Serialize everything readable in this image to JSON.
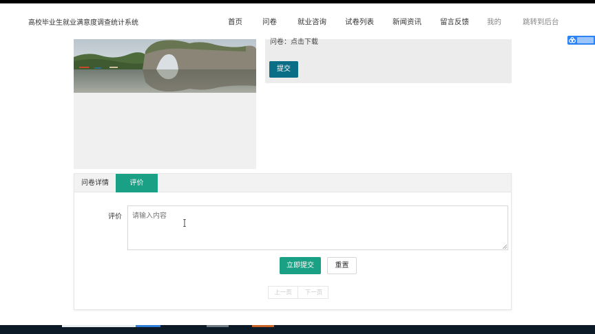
{
  "header": {
    "brand": "高校毕业生就业满意度调查统计系统",
    "nav": [
      {
        "label": "首页"
      },
      {
        "label": "问卷"
      },
      {
        "label": "就业咨询"
      },
      {
        "label": "试卷列表"
      },
      {
        "label": "新闻资讯"
      },
      {
        "label": "留言反馈"
      },
      {
        "label": "我的"
      },
      {
        "label": "跳转到后台"
      }
    ]
  },
  "info": {
    "file_text": "问卷：点击下载",
    "submit_label": "提交"
  },
  "tabs": [
    {
      "label": "问卷详情",
      "active": false
    },
    {
      "label": "评价",
      "active": true
    }
  ],
  "comment_form": {
    "label": "评价",
    "placeholder": "请输入内容",
    "value": "",
    "submit_label": "立即提交",
    "reset_label": "重置"
  },
  "pager": {
    "prev_label": "上一页",
    "next_label": "下一页"
  },
  "colors": {
    "accent": "#1aa084",
    "submit": "#0a6e86",
    "side_badge": "#2b83f6"
  },
  "icons": {
    "side_badge": "baidu-cloud-icon",
    "text_cursor": "ibeam-cursor-icon"
  }
}
